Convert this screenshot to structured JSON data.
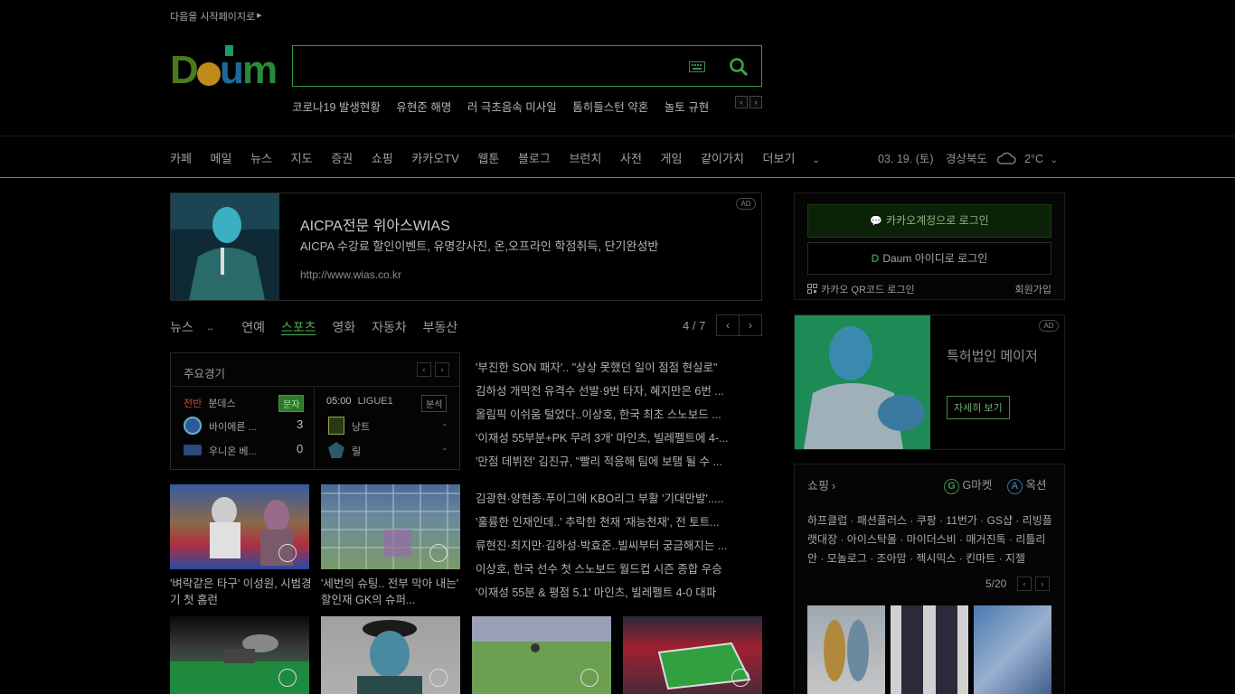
{
  "top": {
    "start_link": "다음을 시작페이지로"
  },
  "search": {
    "value": "",
    "placeholder": ""
  },
  "trends": [
    "코로나19 발생현황",
    "유현준 해명",
    "러 극초음속 미사일",
    "톰히들스턴 약혼",
    "놀토 규현"
  ],
  "nav": {
    "items": [
      "카페",
      "메일",
      "뉴스",
      "지도",
      "증권",
      "쇼핑",
      "카카오TV",
      "웹툰",
      "블로그",
      "브런치",
      "사전",
      "게임",
      "같이가치"
    ],
    "more": "더보기",
    "date": "03. 19. (토)",
    "location": "경상북도",
    "temp": "2°C"
  },
  "ad_banner": {
    "badge": "AD",
    "title": "AICPA전문 위아스WIAS",
    "desc": "AICPA 수강료 할인이벤트, 유명강사진, 온,오프라인 학점취득, 단기완성반",
    "url": "http://www.wias.co.kr"
  },
  "news_tabs": {
    "items": [
      "뉴스",
      "연예",
      "스포츠",
      "영화",
      "자동차",
      "부동산"
    ],
    "active": "스포츠",
    "page": "4 / 7"
  },
  "match": {
    "title": "주요경기",
    "left": {
      "status": "전반",
      "league": "분데스",
      "tag": "문자",
      "team1": "바이에른 ...",
      "score1": "3",
      "team2": "우니온 베...",
      "score2": "0"
    },
    "right": {
      "time": "05:00",
      "league": "LIGUE1",
      "tag": "분석",
      "team1": "낭트",
      "score1": "-",
      "team2": "릴",
      "score2": "-"
    }
  },
  "headlines_top": [
    "'부진한 SON 패자'.. \"상상 못했던 일이 점점 현실로\"",
    "김하성 개막전 유격수 선발·9번 타자, 혜지만은 6번 ...",
    "올림픽 이쉬움 털었다..이상호, 한국 최초 스노보드 ...",
    "'이재성 55부분+PK 무려 3개' 마인츠, 빌레펠트에 4-...",
    "'만점 데뷔전' 김진규, \"빨리 적응해 팀에 보탬 될 수 ..."
  ],
  "headlines_bottom": [
    "김광현·양현종·푸이그에 KBO리그 부활 '기대만발'.....",
    "'훌륭한 인재인데..' 추락한 천재 '재능천재', 전 토트...",
    "류현진·최지만·김하성·박효준..빌씨부터 궁금해지는 ...",
    "이상호, 한국 선수 첫 스노보드 월드컵 시즌 종합 우승",
    "'이재성 55분 & 평점 5.1' 마인츠, 빌레펠트 4-0 대파"
  ],
  "thumbs": [
    {
      "caption": "'벼락같은 타구' 이성원, 시범경기 첫 홈런"
    },
    {
      "caption": "'세번의 슈팅.. 전부 막아 내는' 할인재 GK의 슈퍼..."
    }
  ],
  "login": {
    "kakao_label": "카카오계정으로 로그인",
    "daum_label": "Daum 아이디로 로그인",
    "qr_label": "카카오 QR코드 로그인",
    "signup_label": "회원가입"
  },
  "ad2": {
    "badge": "AD",
    "text": "특허법인 메이저",
    "button": "자세히 보기"
  },
  "shopping": {
    "title": "쇼핑",
    "gmarket": "G마켓",
    "auction": "옥션",
    "links": "하프클럽 · 패션플러스 · 쿠팡 · 11번가 · GS샵 · 리빙플랫대장 · 아이스탁몰 · 마이더스비 · 매거진톡 · 리틀리안 · 모놀로그 · 조아맘 · 젝시믹스 · 킨마트 · 지젤",
    "page": "5/20"
  },
  "colors": {
    "accent_green": "#2e9a3a",
    "active_tab": "#4cb050"
  }
}
